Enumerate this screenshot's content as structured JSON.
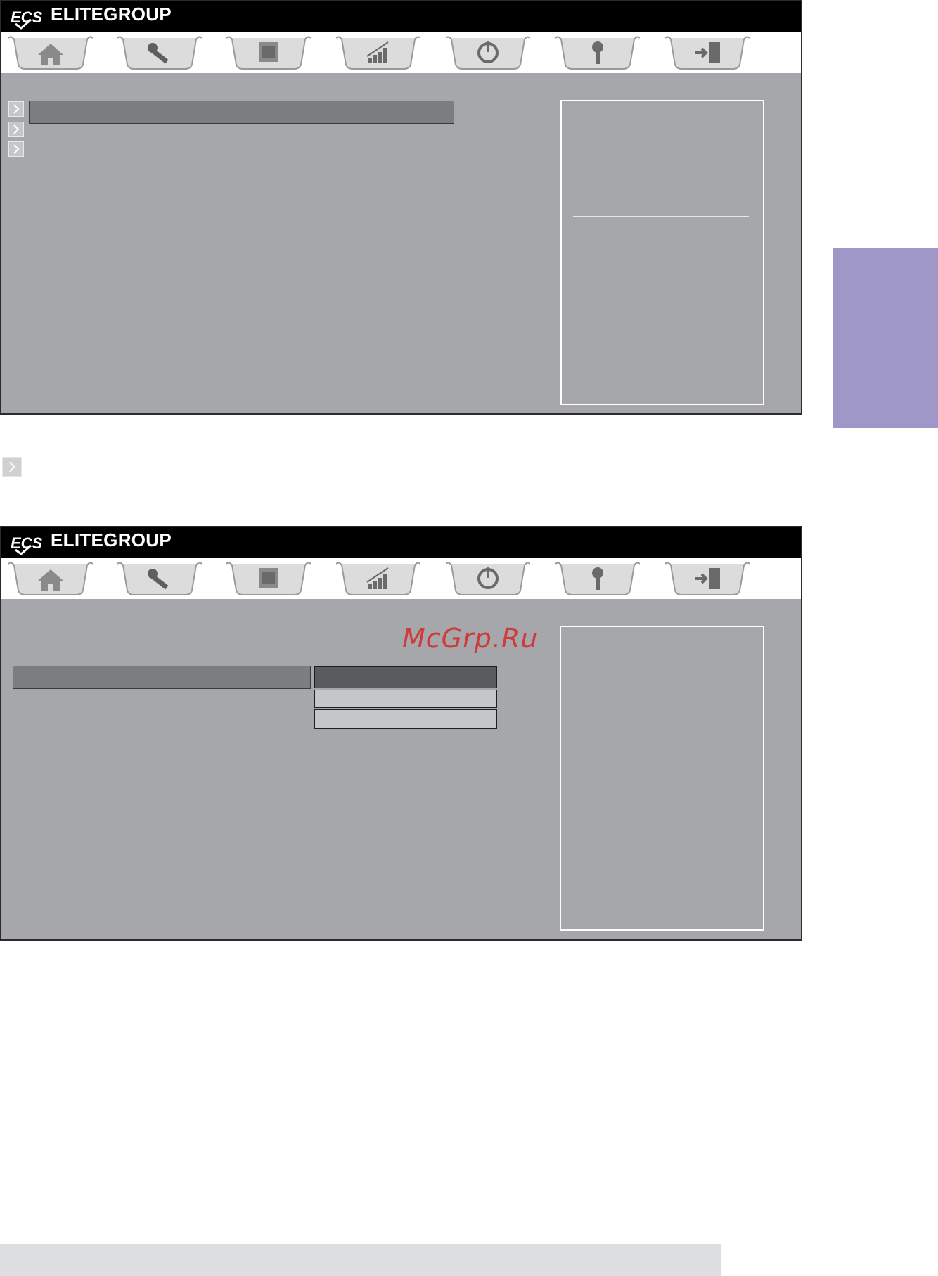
{
  "screens": [
    {
      "brand": {
        "name": "ELITEGROUP",
        "logo": "ecs-logo"
      },
      "tabs": [
        {
          "icon": "home-icon"
        },
        {
          "icon": "wrench-icon"
        },
        {
          "icon": "chip-icon"
        },
        {
          "icon": "performance-chart-icon"
        },
        {
          "icon": "power-icon"
        },
        {
          "icon": "key-icon"
        },
        {
          "icon": "exit-door-icon"
        }
      ],
      "menu_items": [
        {
          "selected": true
        },
        {
          "selected": false
        },
        {
          "selected": false
        }
      ]
    },
    {
      "brand": {
        "name": "ELITEGROUP",
        "logo": "ecs-logo"
      },
      "tabs": [
        {
          "icon": "home-icon"
        },
        {
          "icon": "wrench-icon"
        },
        {
          "icon": "chip-icon"
        },
        {
          "icon": "performance-chart-icon"
        },
        {
          "icon": "power-icon"
        },
        {
          "icon": "key-icon"
        },
        {
          "icon": "exit-door-icon"
        }
      ],
      "options_popup": {
        "options": [
          {
            "selected": true
          },
          {
            "selected": false
          },
          {
            "selected": false
          }
        ]
      }
    }
  ],
  "watermark": "McGrp.Ru",
  "colors": {
    "bios_background": "#a6a7ab",
    "title_bar": "#000000",
    "highlight": "#7c7d80",
    "selected_option": "#5a5b5e",
    "option": "#c5c6c9",
    "side_tab": "#9f97c8",
    "watermark": "#cf3a3a"
  }
}
